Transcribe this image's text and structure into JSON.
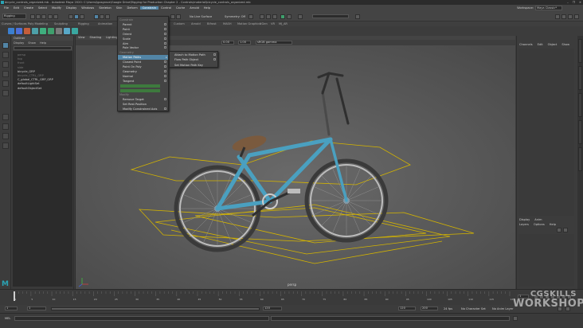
{
  "window": {
    "title": "bicycle_controls_organized.mb - Autodesk Maya 2020: C:\\Users\\lgosgrove\\Google Drive\\Rigging for Production Chapter 2 - Controls\\material\\bicycle_controls_organized.mb",
    "controls": [
      "–",
      "❐",
      "✕"
    ]
  },
  "menubar": {
    "items": [
      "File",
      "Edit",
      "Create",
      "Select",
      "Modify",
      "Display",
      "Windows",
      "Skeleton",
      "Skin",
      "Deform",
      "Constrain",
      "Control",
      "Cache",
      "Arnold",
      "Help"
    ],
    "active_index": 10,
    "workspace_label": "Workspace:",
    "workspace_value": "Maya Classic*"
  },
  "statusline": {
    "mode": "Rigging",
    "no_live_surface": "No Live Surface",
    "symmetry": "Symmetry: Off"
  },
  "shelf": {
    "tabs": [
      "Curves / Surfaces",
      "Poly Modeling",
      "Sculpting",
      "Rigging",
      "Animation",
      "Rendering",
      "FX",
      "FX Caching",
      "Custom",
      "Arnold",
      "Bifrost",
      "MASH",
      "Motion Graphics",
      "XGen",
      "VR",
      "MJ_AR"
    ],
    "icon_colors": [
      "#3b7fd0",
      "#4d6fd8",
      "#c45d3a",
      "#4da0a8",
      "#3fae7e",
      "#3f9f6d",
      "#7a7a7a",
      "#58a8c8",
      "#3aa7a0"
    ]
  },
  "outliner": {
    "title": "Outliner",
    "tabs": [
      "Display",
      "Show",
      "Help"
    ],
    "items": [
      {
        "label": "persp",
        "dim": true
      },
      {
        "label": "top",
        "dim": true
      },
      {
        "label": "front",
        "dim": true
      },
      {
        "label": "side",
        "dim": true
      },
      {
        "label": "bicycle_GRP",
        "dim": false
      },
      {
        "label": "bicycle_CTRL_GRP",
        "dim": true
      },
      {
        "label": "C_global_CTRL_GRP_GRP",
        "dim": false
      },
      {
        "label": "defaultLightSet",
        "dim": false
      },
      {
        "label": "defaultObjectSet",
        "dim": false
      }
    ]
  },
  "viewport": {
    "menu": [
      "View",
      "Shading",
      "Lighting",
      "Show",
      "Renderer",
      "Panels"
    ],
    "gamma_label": "sRGB gamma",
    "exposure_value": "0.00",
    "gamma_value": "1.00",
    "camera_label": "persp"
  },
  "constrain_menu": {
    "items": [
      {
        "label": "Constrain",
        "kind": "section"
      },
      {
        "label": "Parent",
        "kind": "item",
        "option": true
      },
      {
        "label": "Point",
        "kind": "item",
        "option": true
      },
      {
        "label": "Orient",
        "kind": "item",
        "option": true
      },
      {
        "label": "Scale",
        "kind": "item",
        "option": true
      },
      {
        "label": "Aim",
        "kind": "item",
        "option": true
      },
      {
        "label": "Pole Vector",
        "kind": "item",
        "option": true
      },
      {
        "label": "Geometry",
        "kind": "section"
      },
      {
        "label": "Motion Paths",
        "kind": "highlight",
        "arrow": "▸"
      },
      {
        "label": "Closest Point",
        "kind": "item",
        "option": true
      },
      {
        "label": "Point On Poly",
        "kind": "item",
        "option": true
      },
      {
        "label": "Geometry",
        "kind": "item",
        "option": true
      },
      {
        "label": "Normal",
        "kind": "item",
        "option": true
      },
      {
        "label": "Tangent",
        "kind": "item",
        "option": true
      },
      {
        "label": "Rivet",
        "kind": "green"
      },
      {
        "label": "Proximity Pin",
        "kind": "green"
      },
      {
        "label": "Modify",
        "kind": "section"
      },
      {
        "label": "Remove Target",
        "kind": "item",
        "option": true
      },
      {
        "label": "Set Rest Position",
        "kind": "item",
        "option": false
      },
      {
        "label": "Modify Constrained Axis",
        "kind": "item",
        "option": true
      }
    ]
  },
  "motion_paths_submenu": {
    "items": [
      {
        "label": "Attach to Motion Path",
        "option": true
      },
      {
        "label": "Flow Path Object",
        "option": true
      },
      {
        "label": "Set Motion Path Key",
        "option": false
      }
    ]
  },
  "channel_box": {
    "tabs": [
      "Channels",
      "Edit",
      "Object",
      "Show"
    ],
    "layer_tabs": [
      "Display",
      "Anim"
    ],
    "layer_menu": [
      "Layers",
      "Options",
      "Help"
    ]
  },
  "timeline": {
    "tick_labels": [
      "1",
      "5",
      "10",
      "15",
      "20",
      "25",
      "30",
      "35",
      "40",
      "45",
      "50",
      "55",
      "60",
      "65",
      "70",
      "75",
      "80",
      "85",
      "90",
      "95",
      "100",
      "105",
      "110",
      "115",
      "120"
    ],
    "current_frame": "1",
    "range_start": "1",
    "range_start_inner": "1",
    "range_end_inner": "120",
    "range_end": "120",
    "range_end_outer": "200",
    "fps": "24 fps",
    "no_character_set": "No Character Set",
    "no_anim_layer": "No Anim Layer"
  },
  "cmdline": {
    "lang": "MEL"
  },
  "watermark": {
    "line1": "CGSKILLS",
    "line2": "WORKSHOP"
  },
  "colors": {
    "highlight": "#5285a6",
    "bike_frame": "#4aa0c0",
    "control_curve": "#d4b400",
    "seat": "#7a5a3e"
  }
}
